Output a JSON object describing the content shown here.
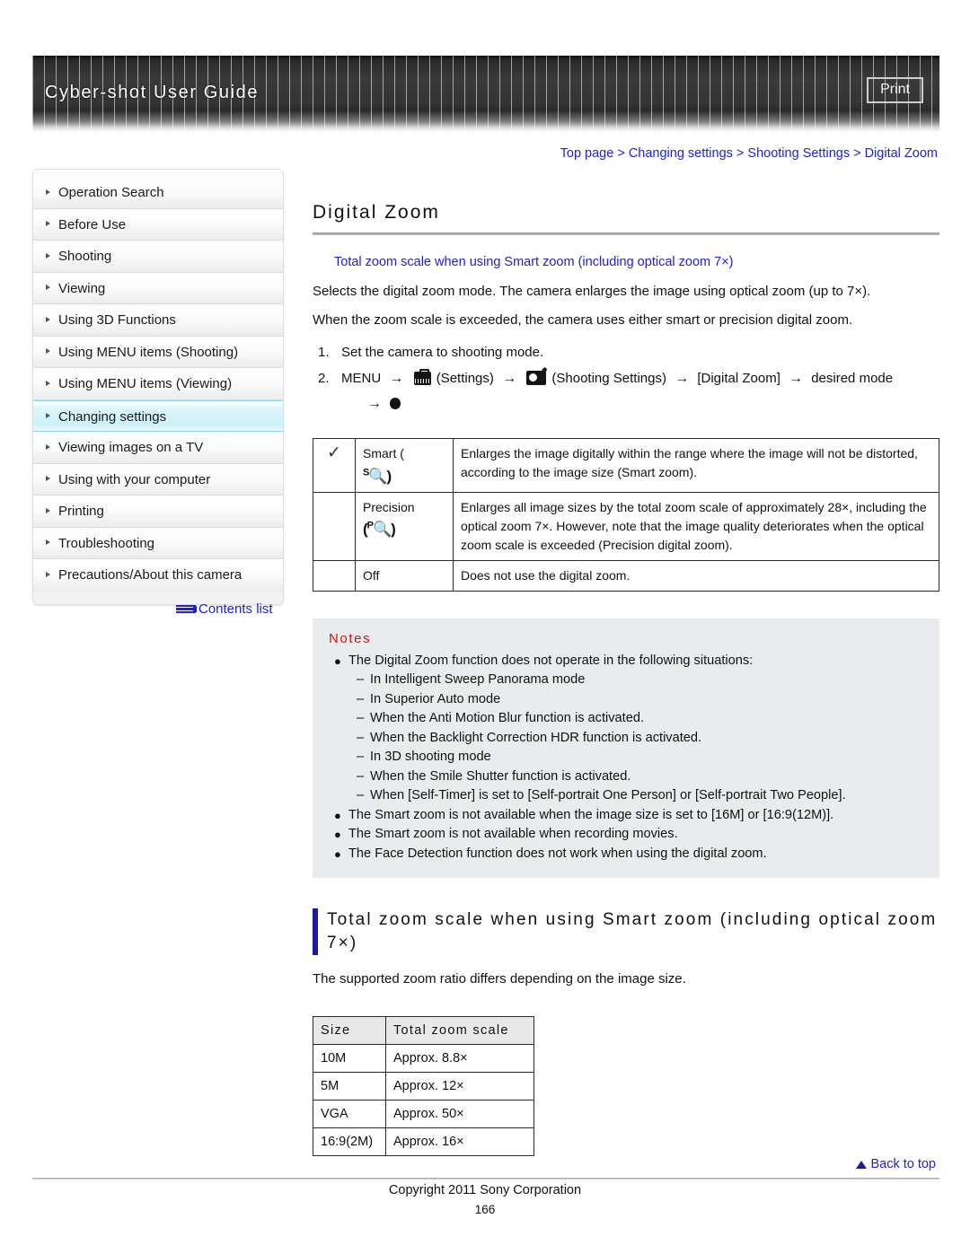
{
  "header": {
    "title": "Cyber-shot User Guide",
    "print_label": "Print"
  },
  "breadcrumb": {
    "text": "Top page > Changing settings > Shooting Settings > Digital Zoom"
  },
  "sidebar": {
    "items": [
      {
        "label": "Operation Search",
        "active": false
      },
      {
        "label": "Before Use",
        "active": false
      },
      {
        "label": "Shooting",
        "active": false
      },
      {
        "label": "Viewing",
        "active": false
      },
      {
        "label": "Using 3D Functions",
        "active": false
      },
      {
        "label": "Using MENU items (Shooting)",
        "active": false
      },
      {
        "label": "Using MENU items (Viewing)",
        "active": false
      },
      {
        "label": "Changing settings",
        "active": true
      },
      {
        "label": "Viewing images on a TV",
        "active": false
      },
      {
        "label": "Using with your computer",
        "active": false
      },
      {
        "label": "Printing",
        "active": false
      },
      {
        "label": "Troubleshooting",
        "active": false
      },
      {
        "label": "Precautions/About this camera",
        "active": false
      }
    ],
    "contents_list_label": "Contents list"
  },
  "main": {
    "page_title": "Digital Zoom",
    "anchor_link": "Total zoom scale when using Smart zoom (including optical zoom 7×)",
    "intro_line1": "Selects the digital zoom mode. The camera enlarges the image using optical zoom (up to 7×).",
    "intro_line2": "When the zoom scale is exceeded, the camera uses either smart or precision digital zoom.",
    "steps": [
      {
        "num": "1.",
        "text": "Set the camera to shooting mode."
      }
    ],
    "step2": {
      "num": "2.",
      "menu_label": "MENU",
      "settings_label": "(Settings)",
      "shooting_settings_label": "(Shooting Settings)",
      "bracket_label": "[Digital Zoom]",
      "desired_label": "desired mode",
      "arrow": "→"
    },
    "mode_table": {
      "rows": [
        {
          "checked": "✓",
          "name": "Smart (",
          "icon_prefix": "S",
          "icon_glyph": "⚲",
          "name_suffix": ")",
          "description": "Enlarges the image digitally within the range where the image will not be distorted, according to the image size (Smart zoom)."
        },
        {
          "checked": "",
          "name": "Precision",
          "icon_prefix": "P",
          "icon_glyph": "⚲",
          "name_suffix": "",
          "description": "Enlarges all image sizes by the total zoom scale of approximately 28×, including the optical zoom 7×. However, note that the image quality deteriorates when the optical zoom scale is exceeded (Precision digital zoom)."
        },
        {
          "checked": "",
          "name": "Off",
          "icon_prefix": "",
          "icon_glyph": "",
          "name_suffix": "",
          "description": "Does not use the digital zoom."
        }
      ]
    },
    "notes": {
      "title": "Notes",
      "items": [
        {
          "type": "bullet",
          "text": "The Digital Zoom function does not operate in the following situations:"
        },
        {
          "type": "dash",
          "text": "In Intelligent Sweep Panorama mode"
        },
        {
          "type": "dash",
          "text": "In Superior Auto mode"
        },
        {
          "type": "dash",
          "text": "When the Anti Motion Blur function is activated."
        },
        {
          "type": "dash",
          "text": "When the Backlight Correction HDR function is activated."
        },
        {
          "type": "dash",
          "text": "In 3D shooting mode"
        },
        {
          "type": "dash",
          "text": "When the Smile Shutter function is activated."
        },
        {
          "type": "dash",
          "text": "When [Self-Timer] is set to [Self-portrait One Person] or [Self-portrait Two People]."
        },
        {
          "type": "bullet",
          "text": "The Smart zoom is not available when the image size is set to [16M] or [16:9(12M)]."
        },
        {
          "type": "bullet",
          "text": "The Smart zoom is not available when recording movies."
        },
        {
          "type": "bullet",
          "text": "The Face Detection function does not work when using the digital zoom."
        }
      ]
    },
    "section_heading": "Total zoom scale when using Smart zoom (including optical zoom 7×)",
    "section_intro": "The supported zoom ratio differs depending on the image size.",
    "zoom_table": {
      "headers": [
        "Size",
        "Total zoom scale"
      ],
      "rows": [
        [
          "10M",
          "Approx. 8.8×"
        ],
        [
          "5M",
          "Approx. 12×"
        ],
        [
          "VGA",
          "Approx. 50×"
        ],
        [
          "16:9(2M)",
          "Approx. 16×"
        ]
      ]
    }
  },
  "footer": {
    "back_to_top": "Back to top",
    "copyright": "Copyright 2011 Sony Corporation",
    "page_number": "166"
  }
}
